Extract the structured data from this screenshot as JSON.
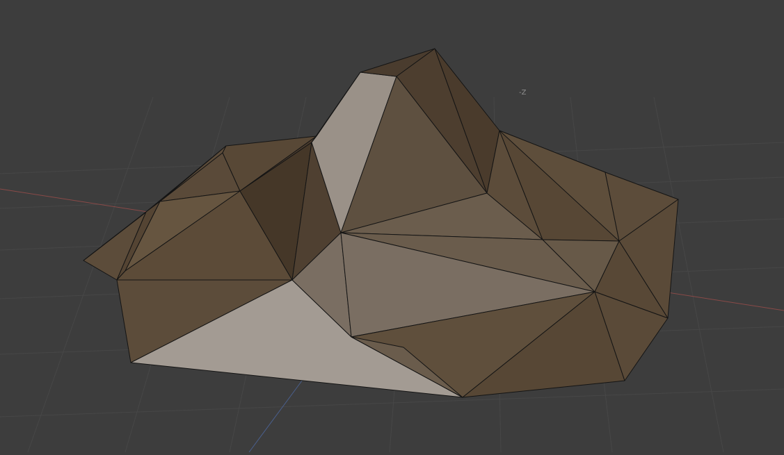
{
  "viewport": {
    "axis_label": "-Z"
  },
  "colors": {
    "background": "#3d3d3d",
    "grid": "#474747",
    "x_axis": "#8a4a48",
    "y_axis": "#4a5f8c",
    "edge": "#141414",
    "face_dark": "#453728",
    "face_mid": "#5c4c3a",
    "face_light": "#9a9188",
    "face_lightest": "#b0a8a0"
  },
  "icons": [
    "grid-floor",
    "x-axis-line",
    "y-axis-line",
    "low-poly-mountain-mesh"
  ]
}
